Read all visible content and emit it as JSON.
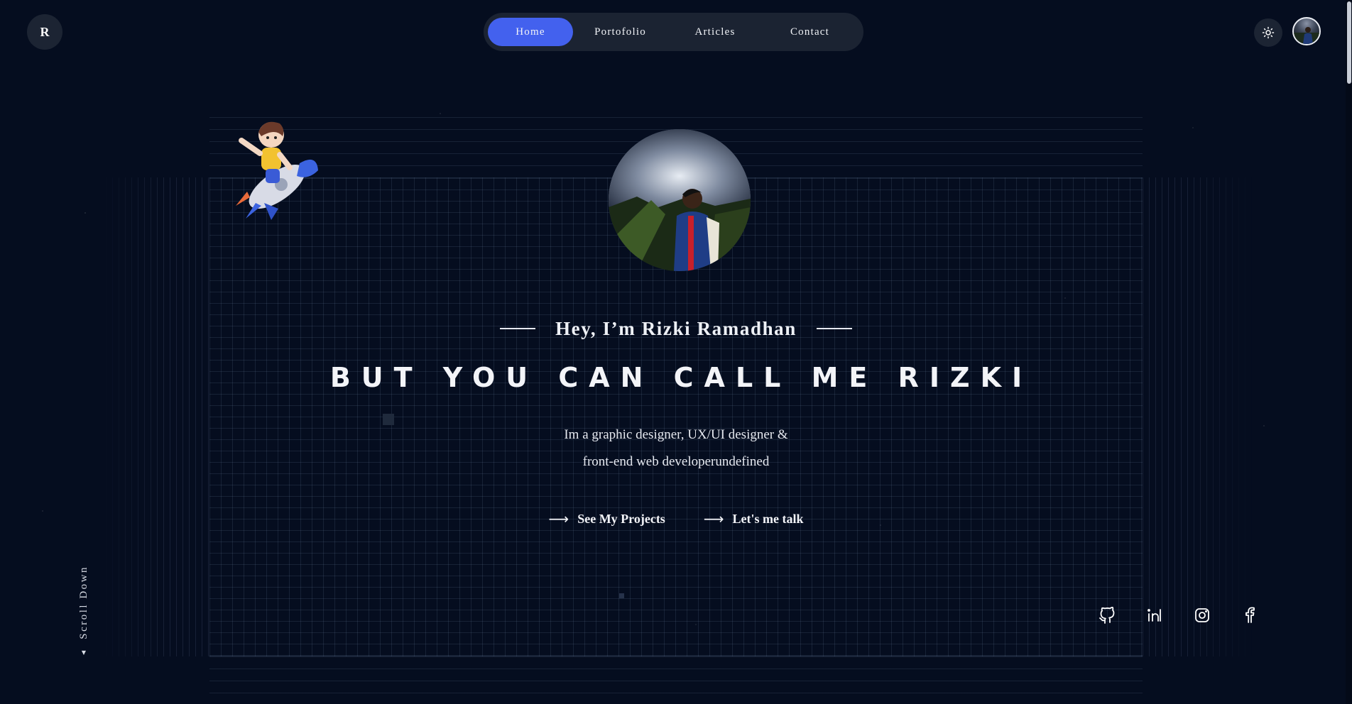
{
  "header": {
    "logo_letter": "R",
    "nav": [
      {
        "label": "Home",
        "active": true
      },
      {
        "label": "Portofolio",
        "active": false
      },
      {
        "label": "Articles",
        "active": false
      },
      {
        "label": "Contact",
        "active": false
      }
    ],
    "theme_toggle_icon": "sun-icon",
    "avatar_icon": "user-avatar"
  },
  "hero": {
    "greeting": "Hey, I’m Rizki Ramadhan",
    "headline": "BUT YOU CAN CALL ME RIZKI",
    "tagline_line1": "Im a graphic designer, UX/UI designer &",
    "tagline_line2": "front-end web developerundefined",
    "cta_projects": "See My Projects",
    "cta_talk": "Let's me talk",
    "cta_arrow": "⟶"
  },
  "scroll_hint": "Scroll Down",
  "socials": [
    "github-icon",
    "linkedin-icon",
    "instagram-icon",
    "facebook-icon"
  ],
  "colors": {
    "background": "#050d1f",
    "accent": "#4361ee",
    "surface": "#1b2332",
    "text": "#e6e9f0"
  }
}
